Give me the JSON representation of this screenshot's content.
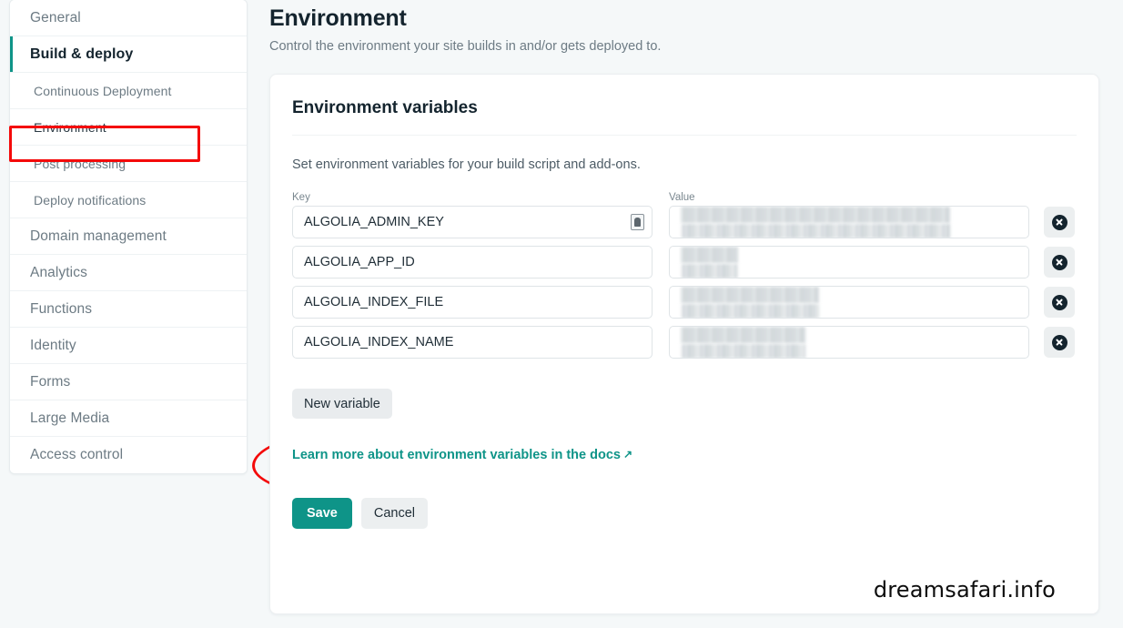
{
  "page": {
    "title": "Environment",
    "subtitle": "Control the environment your site builds in and/or gets deployed to."
  },
  "sidebar": {
    "items": [
      {
        "label": "General",
        "level": 1,
        "state": "normal"
      },
      {
        "label": "Build & deploy",
        "level": 1,
        "state": "active-parent"
      },
      {
        "label": "Continuous Deployment",
        "level": 2,
        "state": "normal"
      },
      {
        "label": "Environment",
        "level": 2,
        "state": "current"
      },
      {
        "label": "Post processing",
        "level": 2,
        "state": "normal"
      },
      {
        "label": "Deploy notifications",
        "level": 2,
        "state": "normal"
      },
      {
        "label": "Domain management",
        "level": 1,
        "state": "normal"
      },
      {
        "label": "Analytics",
        "level": 1,
        "state": "normal"
      },
      {
        "label": "Functions",
        "level": 1,
        "state": "normal"
      },
      {
        "label": "Identity",
        "level": 1,
        "state": "normal"
      },
      {
        "label": "Forms",
        "level": 1,
        "state": "normal"
      },
      {
        "label": "Large Media",
        "level": 1,
        "state": "normal"
      },
      {
        "label": "Access control",
        "level": 1,
        "state": "normal"
      }
    ]
  },
  "card": {
    "title": "Environment variables",
    "description": "Set environment variables for your build script and add-ons.",
    "columns": {
      "key": "Key",
      "value": "Value"
    },
    "variables": [
      {
        "key": "ALGOLIA_ADMIN_KEY",
        "value": "",
        "value_state": "redacted",
        "redaction_width_pct": 80,
        "has_autofill_icon": true
      },
      {
        "key": "ALGOLIA_APP_ID",
        "value": "",
        "value_state": "redacted",
        "redaction_width_pct": 17,
        "has_autofill_icon": false
      },
      {
        "key": "ALGOLIA_INDEX_FILE",
        "value": "",
        "value_state": "redacted",
        "redaction_width_pct": 41,
        "has_autofill_icon": false
      },
      {
        "key": "ALGOLIA_INDEX_NAME",
        "value": "",
        "value_state": "redacted",
        "redaction_width_pct": 37,
        "has_autofill_icon": false
      }
    ],
    "key_placeholder": "Key",
    "value_placeholder": "Value",
    "new_variable_label": "New variable",
    "docs_link_label": "Learn more about environment variables in the docs",
    "docs_link_icon": "external-link-arrow",
    "save_label": "Save",
    "cancel_label": "Cancel",
    "delete_icon_name": "delete-variable-icon"
  },
  "annotations": {
    "rectangle_target": "Environment",
    "ellipse_target": "New variable",
    "color": "#f40a0a"
  },
  "watermark": "dreamsafari.info",
  "colors": {
    "accent_teal": "#0e9488",
    "page_background": "#f5f8f9",
    "annotation_red": "#f40a0a",
    "text_dark": "#14242e",
    "text_muted": "#6d7b84"
  }
}
